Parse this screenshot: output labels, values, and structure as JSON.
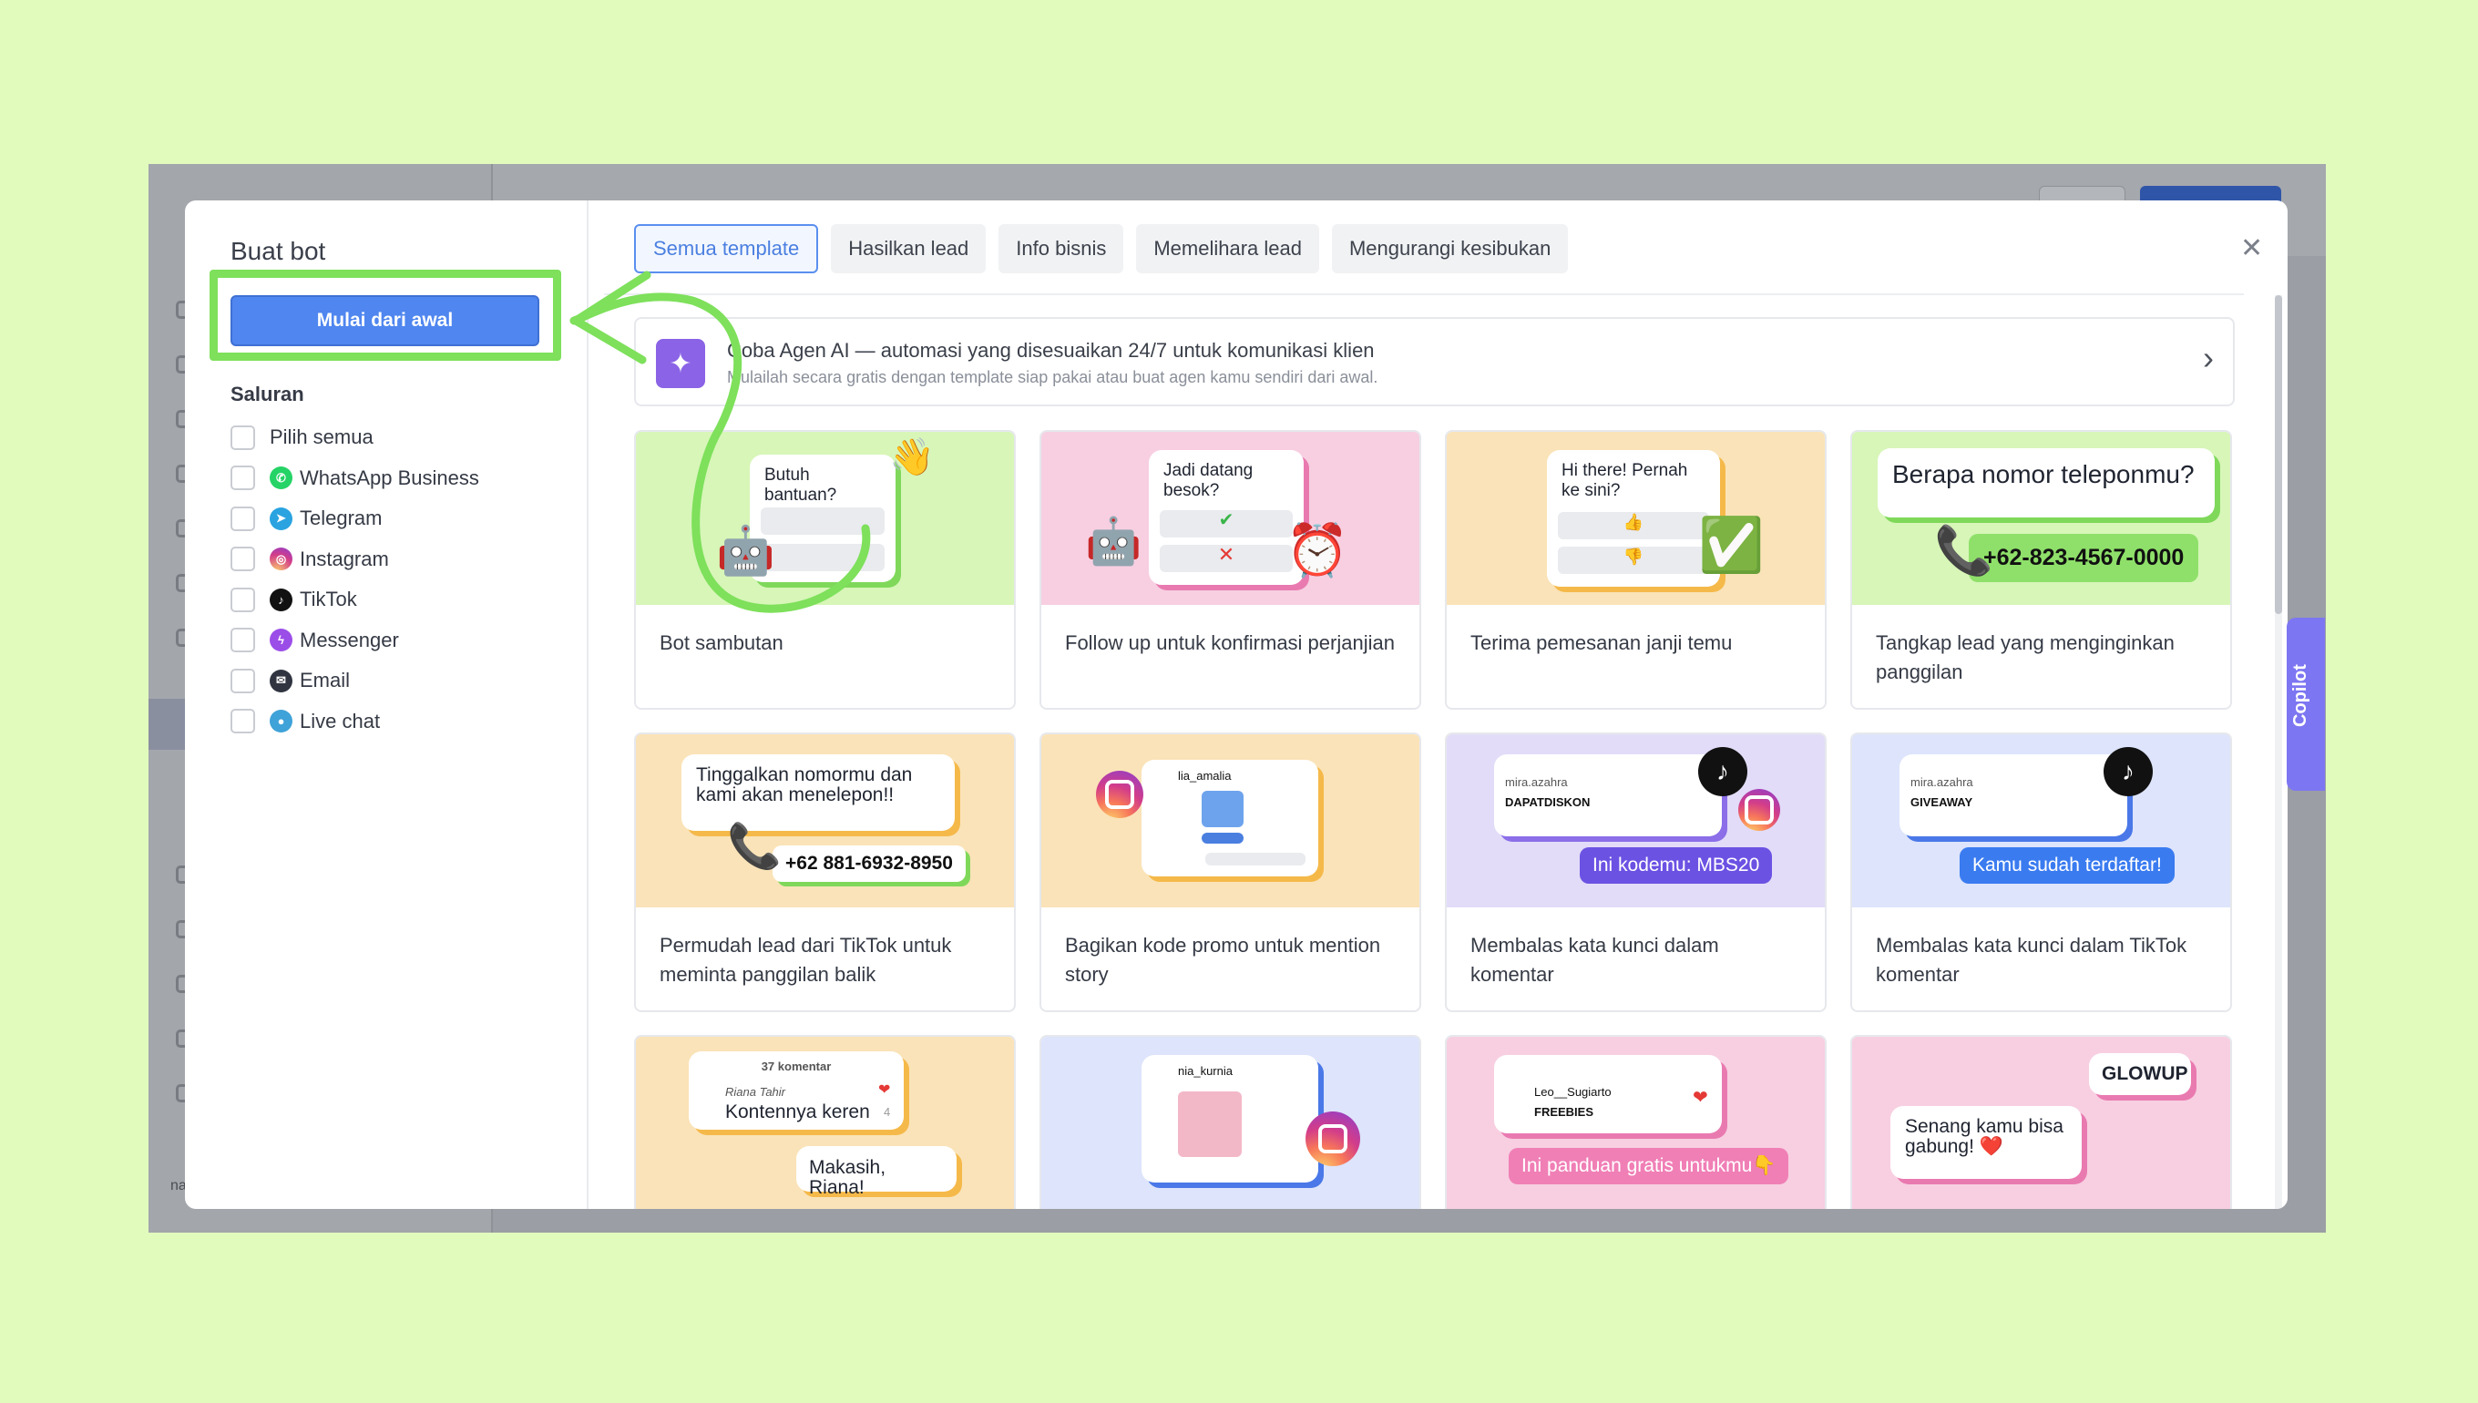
{
  "background_app": {
    "user_label": "nauraramme"
  },
  "modal": {
    "title": "Buat bot",
    "start_button": "Mulai dari awal",
    "channels_heading": "Saluran",
    "channels": [
      {
        "label": "Pilih semua",
        "icon": "none"
      },
      {
        "label": "WhatsApp Business",
        "icon": "whatsapp-icon",
        "color": "#25d366"
      },
      {
        "label": "Telegram",
        "icon": "telegram-icon",
        "color": "#2aa3e0"
      },
      {
        "label": "Instagram",
        "icon": "instagram-icon",
        "color": "#d93d8a"
      },
      {
        "label": "TikTok",
        "icon": "tiktok-icon",
        "color": "#111111"
      },
      {
        "label": "Messenger",
        "icon": "messenger-icon",
        "color": "#9b4de8"
      },
      {
        "label": "Email",
        "icon": "email-icon",
        "color": "#2f3440"
      },
      {
        "label": "Live chat",
        "icon": "live-chat-icon",
        "color": "#3fa2d8"
      }
    ],
    "tabs": [
      "Semua template",
      "Hasilkan lead",
      "Info bisnis",
      "Memelihara lead",
      "Mengurangi kesibukan"
    ],
    "active_tab": "Semua template",
    "banner": {
      "title": "Coba Agen AI — automasi yang disesuaikan 24/7 untuk komunikasi klien",
      "subtitle": "Mulailah secara gratis dengan template siap pakai atau buat agen kamu sendiri dari awal."
    },
    "cards": [
      {
        "label": "Bot sambutan",
        "bg": "#d7f6b8",
        "bubble": "Butuh bantuan?"
      },
      {
        "label": "Follow up untuk konfirmasi perjanjian",
        "bg": "#f7cfe1",
        "bubble": "Jadi datang besok?"
      },
      {
        "label": "Terima pemesanan janji temu",
        "bg": "#fae3b8",
        "bubble": "Hi there! Pernah ke sini?"
      },
      {
        "label": "Tangkap lead yang menginginkan panggilan",
        "bg": "#d7f6b8",
        "bubble": "Berapa nomor teleponmu?",
        "pill": "+62-823-4567-0000"
      },
      {
        "label": "Permudah lead dari TikTok untuk meminta panggilan balik",
        "bg": "#fae3b8",
        "bubble": "Tinggalkan nomormu dan kami akan menelepon!!",
        "pill": "+62 881-6932-8950"
      },
      {
        "label": "Bagikan kode promo untuk mention story",
        "bg": "#fae3b8",
        "user": "lia_amalia"
      },
      {
        "label": "Membalas kata kunci dalam komentar",
        "bg": "#e2dcf8",
        "user": "mira.azahra",
        "keyword": "DAPATDISKON",
        "pill": "Ini kodemu: MBS20"
      },
      {
        "label": "Membalas kata kunci dalam TikTok komentar",
        "bg": "#dde4fb",
        "user": "mira.azahra",
        "keyword": "GIVEAWAY",
        "pill": "Kamu sudah terdaftar!"
      },
      {
        "label": "",
        "bg": "#fae3b8",
        "count": "37 komentar",
        "user": "Riana Tahir",
        "comment": "Kontennya keren",
        "likes": "4",
        "reply": "Makasih, Riana!"
      },
      {
        "label": "",
        "bg": "#dde4fb",
        "user": "nia_kurnia"
      },
      {
        "label": "",
        "bg": "#f7cfe1",
        "user": "Leo__Sugiarto",
        "keyword": "FREEBIES",
        "pill": "Ini panduan gratis untukmu👇"
      },
      {
        "label": "",
        "bg": "#f7cfe1",
        "tag": "GLOWUP",
        "bubble": "Senang kamu bisa gabung! ❤️"
      }
    ],
    "copilot_label": "Copilot"
  }
}
